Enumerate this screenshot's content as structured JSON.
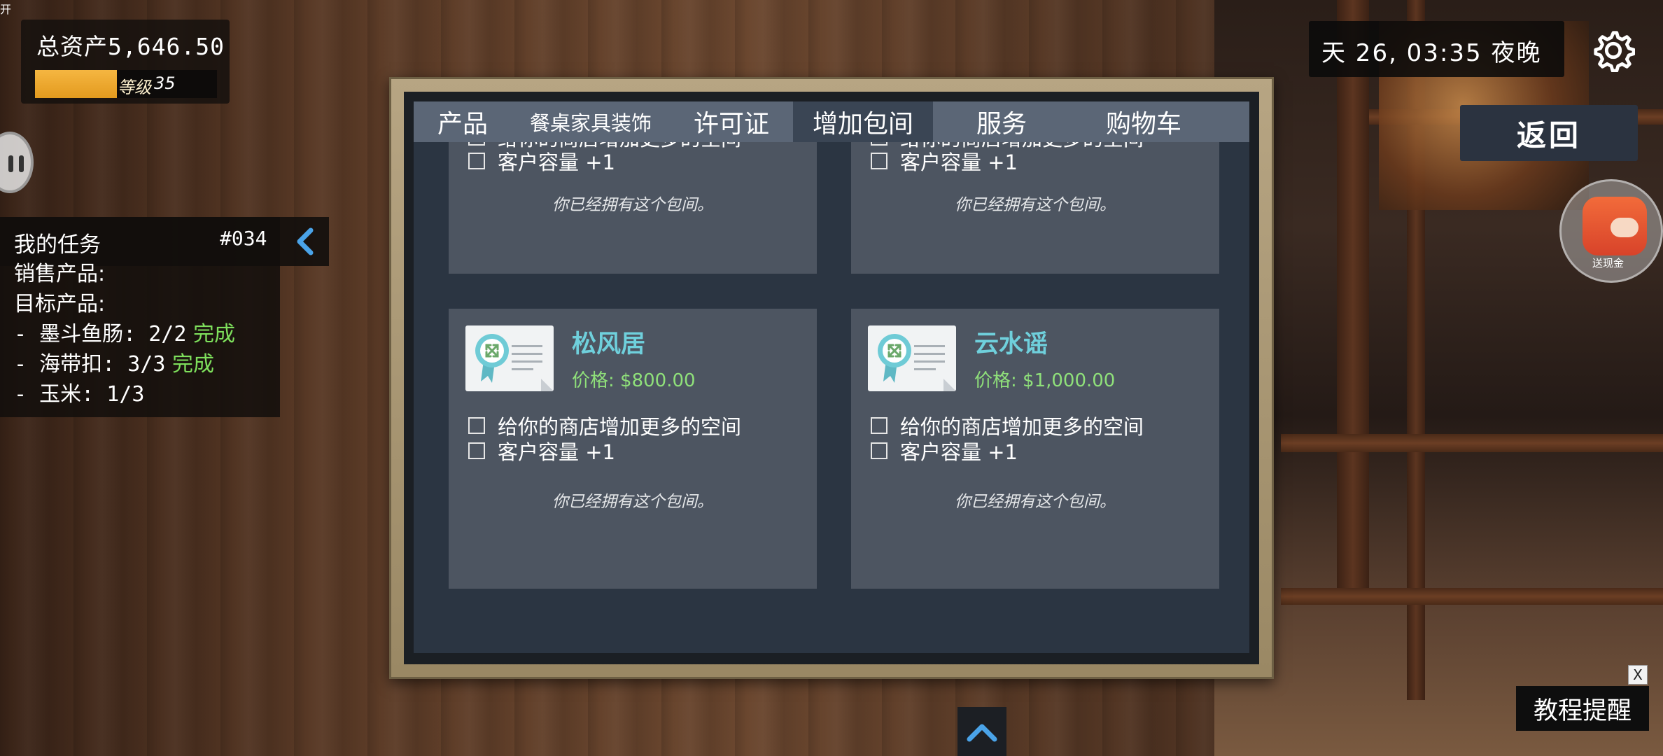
{
  "hud": {
    "total_assets_label": "总资产",
    "total_assets_value": "5,646.50",
    "level_label": "等级",
    "level_value": "35",
    "level_progress": 0.45
  },
  "tasks": {
    "title": "我的任务",
    "id": "#034",
    "sell_label": "销售产品:",
    "target_label": "目标产品:",
    "items": [
      {
        "text": "- 墨斗鱼肠: 2/2",
        "status": "完成"
      },
      {
        "text": "- 海带扣: 3/3",
        "status": "完成"
      },
      {
        "text": "- 玉米: 1/3",
        "status": ""
      }
    ]
  },
  "clock": {
    "text": "天 26, 03:35 夜晚"
  },
  "buttons": {
    "back": "返回",
    "tutorial": "教程提醒",
    "tutorial_close": "X",
    "bonus_label": "送现金"
  },
  "tabs": [
    {
      "label": "产品"
    },
    {
      "label": "餐桌家具装饰"
    },
    {
      "label": "许可证"
    },
    {
      "label": "增加包间",
      "active": true
    },
    {
      "label": "服务"
    },
    {
      "label": "购物车"
    }
  ],
  "rooms": [
    {
      "name": "",
      "price": "",
      "features": [
        "给你的商店增加更多的空间",
        "客户容量 +1"
      ],
      "owned_text": "你已经拥有这个包间。"
    },
    {
      "name": "",
      "price": "",
      "features": [
        "给你的商店增加更多的空间",
        "客户容量 +1"
      ],
      "owned_text": "你已经拥有这个包间。"
    },
    {
      "name": "松风居",
      "price": "价格: $800.00",
      "features": [
        "给你的商店增加更多的空间",
        "客户容量 +1"
      ],
      "owned_text": "你已经拥有这个包间。"
    },
    {
      "name": "云水谣",
      "price": "价格: $1,000.00",
      "features": [
        "给你的商店增加更多的空间",
        "客户容量 +1"
      ],
      "owned_text": "你已经拥有这个包间。"
    }
  ],
  "scene": {
    "sign_char": "开"
  },
  "colors": {
    "room_name": "#6fd0dc",
    "price": "#8fe07a",
    "done": "#7ee05c",
    "level_fill": "#f5b641",
    "collapse_arrow": "#4aa3e8"
  },
  "icons": {
    "settings": "gear-icon",
    "collapse": "chevron-left-icon",
    "expand": "chevron-up-icon",
    "room_thumbnail": "expand-room-certificate-icon",
    "pause": "pause-icon"
  }
}
